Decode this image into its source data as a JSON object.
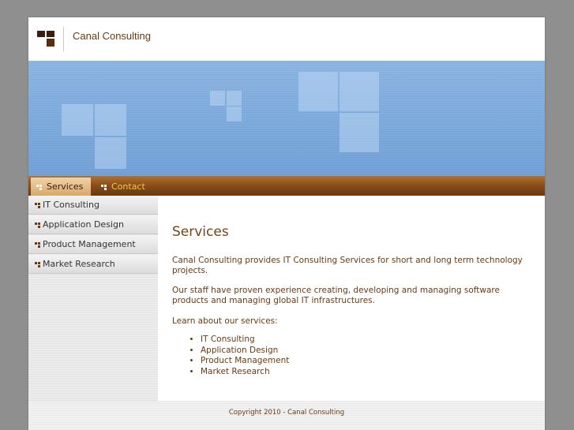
{
  "header": {
    "site_title": "Canal Consulting"
  },
  "nav": {
    "tabs": [
      {
        "label": "Services",
        "active": true
      },
      {
        "label": "Contact",
        "active": false
      }
    ]
  },
  "sidebar": {
    "items": [
      {
        "label": "IT Consulting"
      },
      {
        "label": "Application Design"
      },
      {
        "label": "Product Management"
      },
      {
        "label": "Market Research"
      }
    ]
  },
  "main": {
    "title": "Services",
    "paragraph1": "Canal Consulting provides IT Consulting Services for short and long term technology projects.",
    "paragraph2": "Our staff have proven experience creating, developing and managing software products and managing global IT infrastructures.",
    "paragraph3": "Learn about our services:",
    "services_list": [
      "IT Consulting",
      "Application Design",
      "Product Management",
      "Market Research"
    ]
  },
  "footer": {
    "copyright": "Copyright 2010 - Canal Consulting"
  },
  "colors": {
    "brand_brown": "#6a3a12",
    "nav_brown": "#8a4f1a",
    "banner_blue": "#7aa8db",
    "contact_tab_text": "#f2c94c"
  }
}
